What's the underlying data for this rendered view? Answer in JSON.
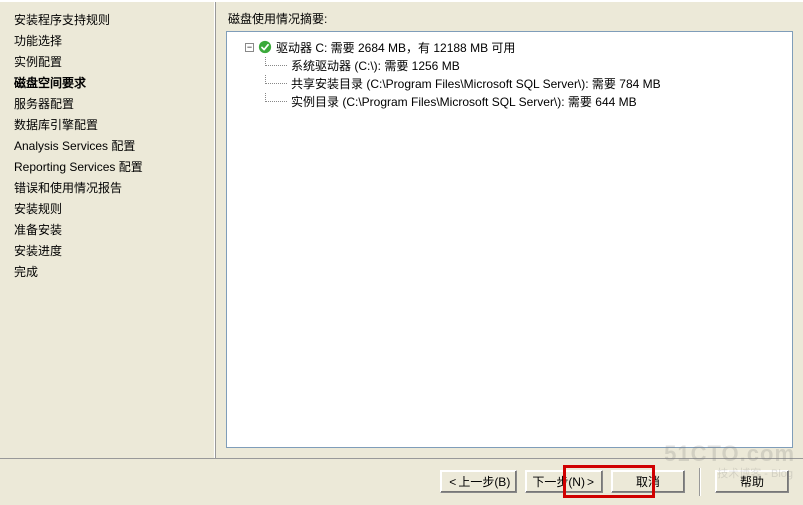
{
  "sidebar": {
    "items": [
      {
        "label": "安装程序支持规则"
      },
      {
        "label": "功能选择"
      },
      {
        "label": "实例配置"
      },
      {
        "label": "磁盘空间要求",
        "selected": true
      },
      {
        "label": "服务器配置"
      },
      {
        "label": "数据库引擎配置"
      },
      {
        "label": "Analysis Services 配置"
      },
      {
        "label": "Reporting Services 配置"
      },
      {
        "label": "错误和使用情况报告"
      },
      {
        "label": "安装规则"
      },
      {
        "label": "准备安装"
      },
      {
        "label": "安装进度"
      },
      {
        "label": "完成"
      }
    ]
  },
  "main": {
    "summary_label": "磁盘使用情况摘要:",
    "tree": {
      "drive_line": "驱动器 C: 需要 2684 MB，有 12188 MB 可用",
      "children": [
        "系统驱动器 (C:\\): 需要 1256 MB",
        "共享安装目录 (C:\\Program Files\\Microsoft SQL Server\\): 需要 784 MB",
        "实例目录 (C:\\Program Files\\Microsoft SQL Server\\): 需要 644 MB"
      ]
    }
  },
  "footer": {
    "back": "上一步(B)",
    "next": "下一步(N)",
    "cancel": "取消",
    "help": "帮助"
  },
  "watermark": {
    "main": "51CTO.com",
    "sub": "技术博客 - Blog"
  }
}
